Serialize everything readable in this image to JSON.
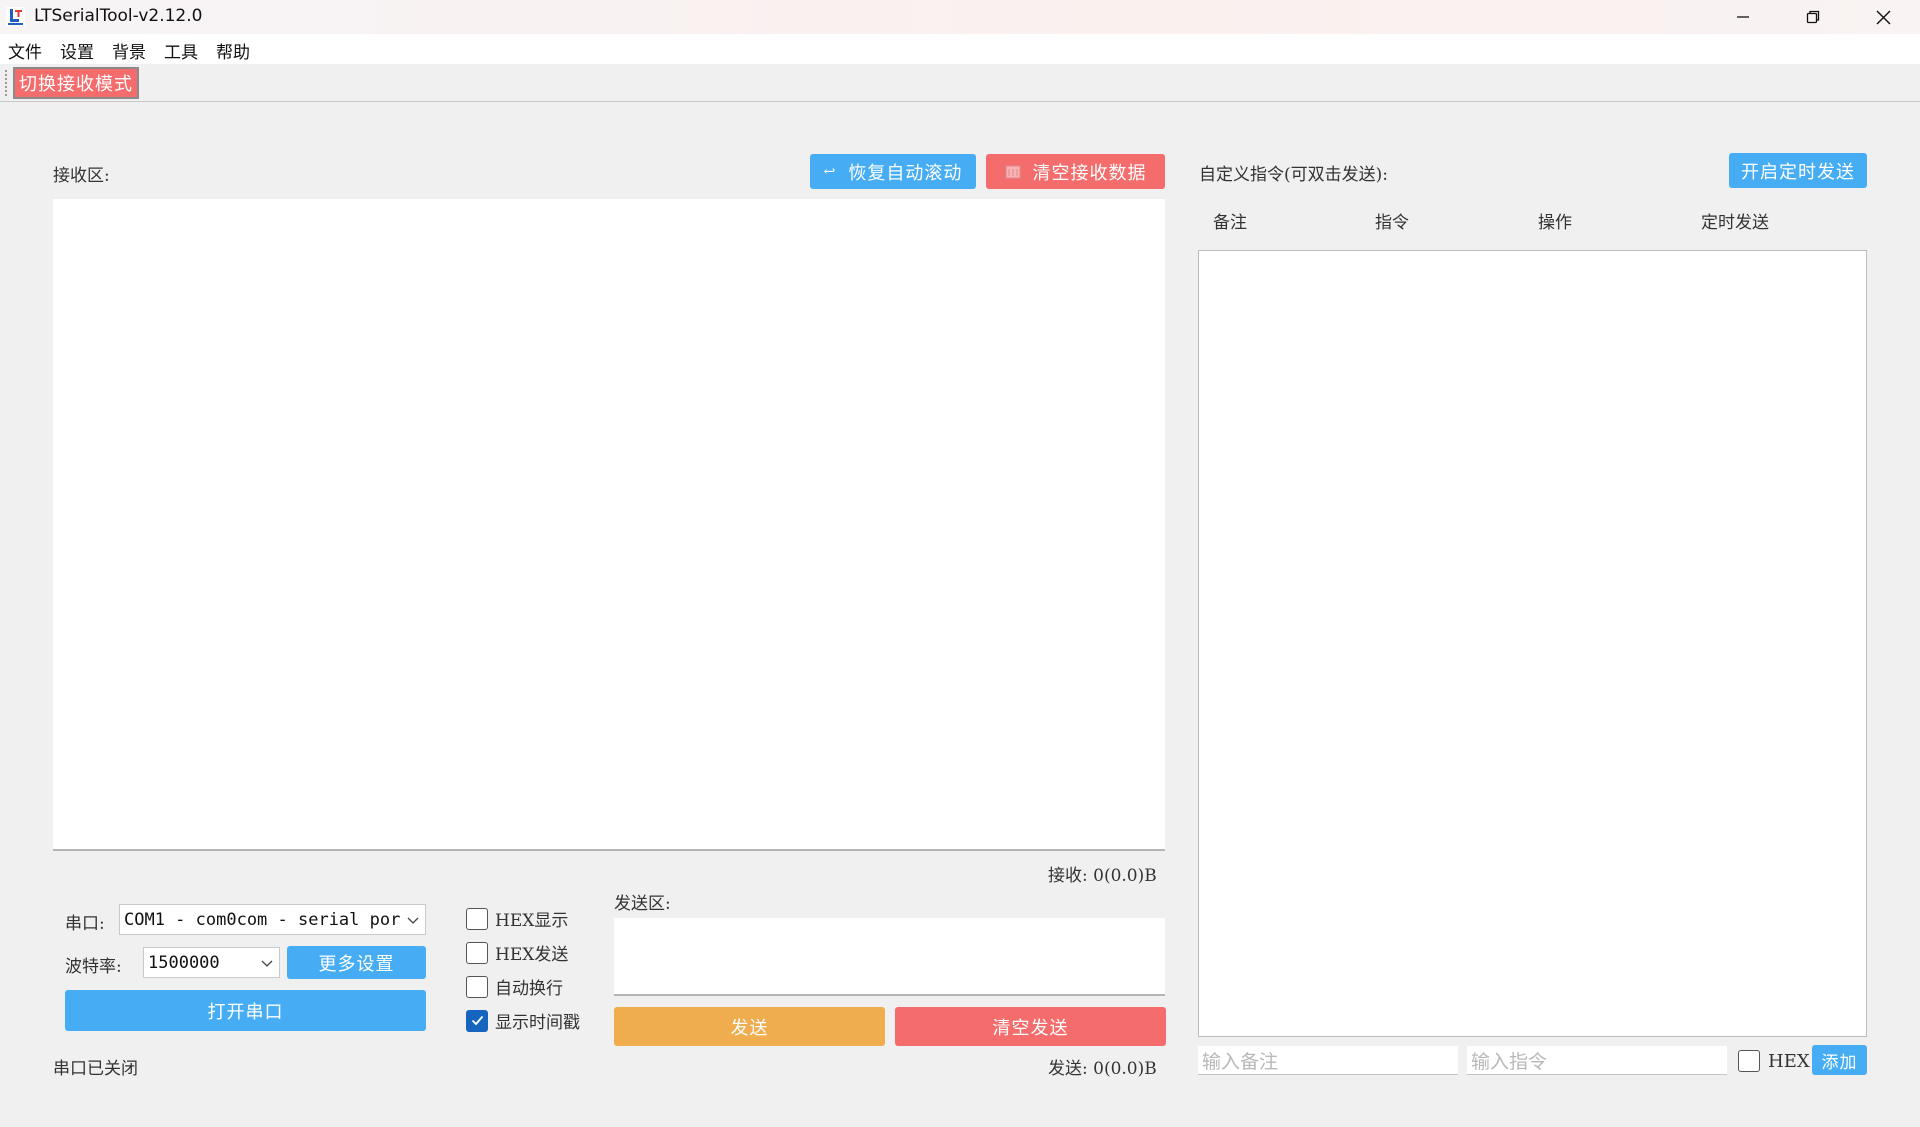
{
  "window": {
    "title": "LTSerialTool-v2.12.0",
    "app_icon": "lt-logo-icon",
    "controls": [
      "minimize-icon",
      "restore-icon",
      "close-icon"
    ]
  },
  "menu": [
    "文件",
    "设置",
    "背景",
    "工具",
    "帮助"
  ],
  "toolbar": {
    "mode_button": "切换接收模式"
  },
  "receive": {
    "label": "接收区:",
    "auto_scroll_button": "恢复自动滚动",
    "auto_scroll_icon": "undo-arrow-icon",
    "clear_button": "清空接收数据",
    "clear_icon": "trash-icon",
    "count": "接收: 0(0.0)B"
  },
  "serial": {
    "port_label": "串口:",
    "port_value": "COM1 - com0com - serial por",
    "baud_label": "波特率:",
    "baud_value": "1500000",
    "more_settings_button": "更多设置",
    "open_button": "打开串口",
    "status": "串口已关闭"
  },
  "options": [
    {
      "label": "HEX显示",
      "checked": false
    },
    {
      "label": "HEX发送",
      "checked": false
    },
    {
      "label": "自动换行",
      "checked": false
    },
    {
      "label": "显示时间戳",
      "checked": true
    }
  ],
  "send": {
    "label": "发送区:",
    "send_button": "发送",
    "clear_button": "清空发送",
    "count": "发送: 0(0.0)B"
  },
  "commands": {
    "label": "自定义指令(可双击发送):",
    "timer_button": "开启定时发送",
    "columns": [
      "备注",
      "指令",
      "操作",
      "定时发送"
    ],
    "note_placeholder": "输入备注",
    "command_placeholder": "输入指令",
    "hex_label": "HEX",
    "hex_checked": false,
    "add_button": "添加"
  },
  "colors": {
    "accent_blue": "#46adf5",
    "danger_red": "#f56c6c",
    "send_orange": "#f0ad4e",
    "checked_blue": "#1565c0"
  }
}
